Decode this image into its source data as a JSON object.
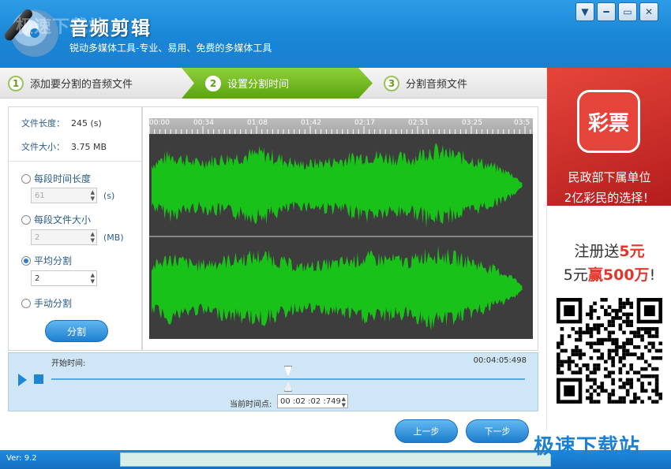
{
  "header": {
    "title": "音频剪辑",
    "subtitle": "锐动多媒体工具-专业、易用、免费的多媒体工具",
    "watermark": "极速下载站",
    "window_controls": [
      "▼",
      "━",
      "▭",
      "✕"
    ]
  },
  "steps": [
    {
      "num": "1",
      "label": "添加要分割的音频文件"
    },
    {
      "num": "2",
      "label": "设置分割时间"
    },
    {
      "num": "3",
      "label": "分割音频文件"
    }
  ],
  "file_info": {
    "length_label": "文件长度：",
    "length_value": "245 (s)",
    "size_label": "文件大小：",
    "size_value": "3.75 MB"
  },
  "options": {
    "by_time_label": "每段时间长度",
    "by_time_value": "61",
    "by_time_unit": "(s)",
    "by_size_label": "每段文件大小",
    "by_size_value": "2",
    "by_size_unit": "(MB)",
    "average_label": "平均分割",
    "average_value": "2",
    "manual_label": "手动分割",
    "selected": "average"
  },
  "split_button": "分割",
  "timeline_ticks": [
    "00:00",
    "00:34",
    "01:08",
    "01:42",
    "02:17",
    "02:51",
    "03:25",
    "03:5"
  ],
  "playback": {
    "start_label": "开始时间:",
    "end_time": "00:04:05:498",
    "current_label": "当前时间点:",
    "current_value": "00 :02 :02 :749"
  },
  "nav": {
    "prev": "上一步",
    "next": "下一步"
  },
  "ad": {
    "icon_text": "彩票",
    "line1": "民政部下属单位",
    "line2": "2亿彩民的选择！",
    "promo1_a": "注册送",
    "promo1_b": "5元",
    "promo2_a": "5元",
    "promo2_b": "赢500万",
    "promo2_c": "!"
  },
  "status": {
    "version": "Ver: 9.2"
  },
  "watermark_bottom": "极速下载站",
  "colors": {
    "header_blue": "#1b86d6",
    "step_green": "#6ab51f",
    "waveform": "#19c219",
    "wave_bg": "#3d3d3d",
    "ad_red": "#d9322a"
  }
}
